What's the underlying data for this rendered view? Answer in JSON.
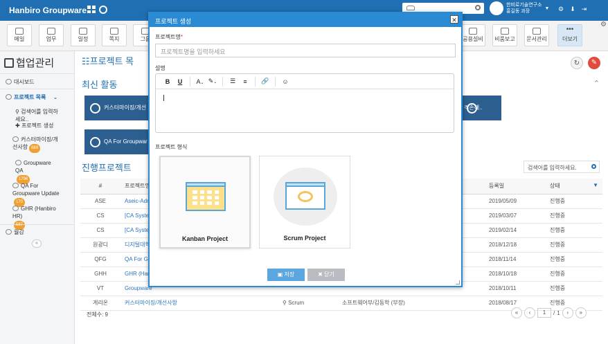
{
  "topbar": {
    "brand": "Hanbiro Groupware",
    "user_line1": "한비로기술연구소",
    "user_line2": "홍길동 과장"
  },
  "nav": {
    "items": [
      "메일",
      "업무",
      "일정",
      "쪽지",
      "그룹",
      "공용설비",
      "비품보고",
      "문서관리",
      "더보기"
    ]
  },
  "sidebar": {
    "title": "협업관리",
    "dashboard": "대시보드",
    "project_list": "프로젝트 목록",
    "search_placeholder": "검색어를 입력하세요..",
    "create": "프로젝트 생성",
    "projects": [
      {
        "name": "커스터마이징/개선사항",
        "count": "689"
      },
      {
        "name": "Groupware QA",
        "count": "1796"
      },
      {
        "name": "QA For Groupware Update",
        "count": "170"
      },
      {
        "name": "GHR (Hanbiro HR)",
        "count": "587"
      }
    ],
    "report": "월감"
  },
  "main": {
    "page_title": "프로젝트 목",
    "recent_title": "최신 활동",
    "recent_cards": [
      "커스터마이징/개선",
      "격손해..",
      "QA For Groupwar"
    ],
    "ongoing_title": "진행프로젝트",
    "search_placeholder": "검색어를 입력하세요.",
    "table": {
      "headers": [
        "#",
        "프로젝트명",
        "",
        "",
        "등록일",
        "상태"
      ],
      "rows": [
        {
          "code": "ASE",
          "name": "Aseic-Adm",
          "type": "",
          "owner": "",
          "date": "2019/05/09",
          "status": "진행중"
        },
        {
          "code": "CS",
          "name": "[CA Syster",
          "type": "",
          "owner": "",
          "date": "2019/03/07",
          "status": "진행중"
        },
        {
          "code": "CS",
          "name": "[CA Syster",
          "type": "",
          "owner": "",
          "date": "2019/02/14",
          "status": "진행중"
        },
        {
          "code": "원광디",
          "name": "디지털대학",
          "type": "",
          "owner": "",
          "date": "2018/12/18",
          "status": "진행중"
        },
        {
          "code": "QFG",
          "name": "QA For Gro",
          "type": "",
          "owner": "",
          "date": "2018/11/14",
          "status": "진행중"
        },
        {
          "code": "GHH",
          "name": "GHR (Hanb",
          "type": "",
          "owner": "",
          "date": "2018/10/18",
          "status": "진행중"
        },
        {
          "code": "VT",
          "name": "Groupware",
          "type": "",
          "owner": "",
          "date": "2018/10/11",
          "status": "진행중"
        },
        {
          "code": "게리온",
          "name": "커스터마이징/개선사항",
          "type": "Scrum",
          "owner": "소프트웨어부/김동학 (부장)",
          "date": "2018/08/17",
          "status": "진행중"
        }
      ]
    },
    "total": "전체수: 9",
    "pager": {
      "page": "1",
      "sep": "/",
      "total": "1"
    }
  },
  "modal": {
    "title": "프로젝트 생성",
    "name_label": "프로젝트명",
    "name_required": "*",
    "name_placeholder": "프로젝트명을 입력하세요",
    "desc_label": "설명",
    "type_label": "프로젝트 형식",
    "types": [
      "Kanban Project",
      "Scrum Project"
    ],
    "save": "저장",
    "close": "닫기"
  }
}
